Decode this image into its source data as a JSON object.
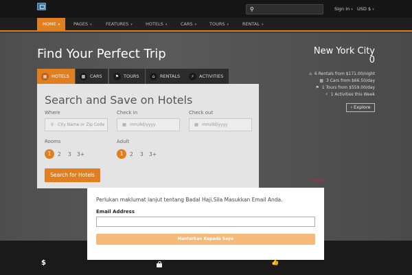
{
  "top": {
    "search_placeholder": "",
    "signin_label": "Sign In",
    "currency_label": "USD $"
  },
  "nav": [
    {
      "label": "HOME"
    },
    {
      "label": "PAGES"
    },
    {
      "label": "FEATURES"
    },
    {
      "label": "HOTELS"
    },
    {
      "label": "CARS"
    },
    {
      "label": "TOURS"
    },
    {
      "label": "RENTAL"
    }
  ],
  "hero": {
    "title": "Find Your Perfect Trip"
  },
  "tabs": [
    {
      "label": "HOTELS",
      "icon": "building-icon"
    },
    {
      "label": "CARS",
      "icon": "car-icon"
    },
    {
      "label": "TOURS",
      "icon": "flag-icon"
    },
    {
      "label": "RENTALS",
      "icon": "home-icon"
    },
    {
      "label": "ACTIVITIES",
      "icon": "bolt-icon"
    }
  ],
  "search_panel": {
    "title": "Search and Save on Hotels",
    "where_label": "Where",
    "where_placeholder": "City Name or Zip Code",
    "checkin_label": "Check in",
    "checkin_placeholder": "mm/dd/yyyy",
    "checkout_label": "Check out",
    "checkout_placeholder": "mm/dd/yyyy",
    "rooms_label": "Rooms",
    "rooms_options": [
      "1",
      "2",
      "3",
      "3+"
    ],
    "adult_label": "Adult",
    "adult_options": [
      "1",
      "2",
      "3",
      "3+"
    ],
    "search_button": "Search for Hotels"
  },
  "sidebar": {
    "city": "New York City",
    "city_count": "0",
    "stats": [
      "6 Rentals from $171.00/night",
      "3 Cars from $66.50/day",
      "1 Tours from $559.00/day",
      "1 Activities this Week"
    ],
    "explore_label": "Explore"
  },
  "popup": {
    "close_label": "close",
    "message": "Perlukan maklumat lanjut tentang Badal Haji.Sila Masukkan Email Anda.",
    "email_label": "Email Address",
    "email_value": "",
    "submit_label": "Hantarkan Kepada Saya"
  },
  "colors": {
    "accent": "#e07f1f",
    "close_red": "#e0192a",
    "submit_bg": "#f5b979"
  }
}
